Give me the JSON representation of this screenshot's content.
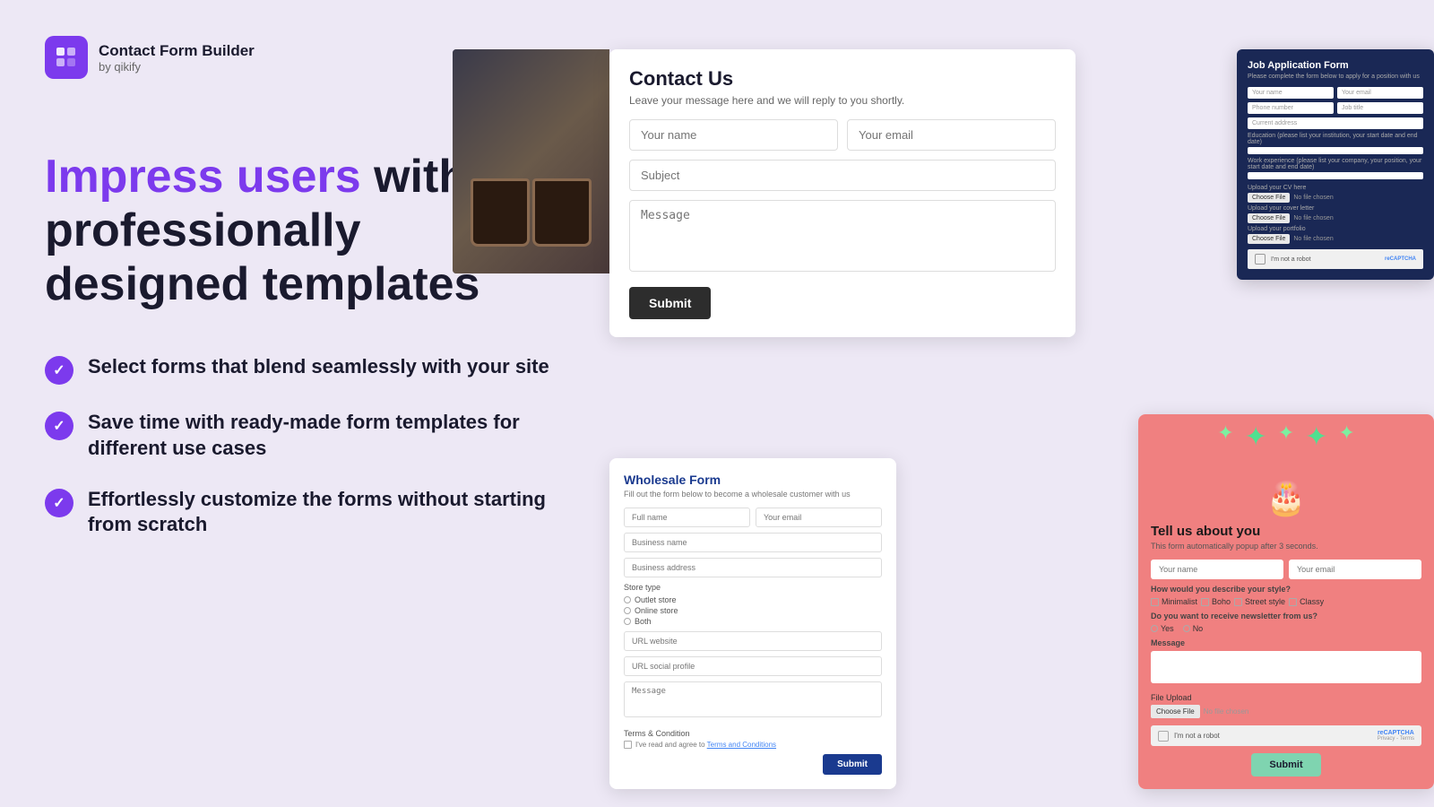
{
  "app": {
    "logo_title": "Contact Form Builder",
    "logo_sub": "by qikify"
  },
  "headline": {
    "highlight": "Impress users",
    "rest": " with professionally designed templates"
  },
  "features": [
    {
      "text": "Select forms that blend seamlessly with your site"
    },
    {
      "text": "Save time with ready-made form templates for different use cases"
    },
    {
      "text": "Effortlessly customize the forms without starting from scratch"
    }
  ],
  "contact_form": {
    "title": "Contact Us",
    "subtitle": "Leave your message here and we will reply to you shortly.",
    "name_placeholder": "Your name",
    "email_placeholder": "Your email",
    "subject_placeholder": "Subject",
    "message_placeholder": "Message",
    "submit_label": "Submit"
  },
  "job_form": {
    "title": "Job Application Form",
    "subtitle": "Please complete the form below to apply for a position with us",
    "name_placeholder": "Your name",
    "email_placeholder": "Your email",
    "phone_placeholder": "Phone number",
    "job_placeholder": "Job title",
    "address_placeholder": "Current address",
    "education_label": "Education (please list your institution, your start date and end date)",
    "work_label": "Work experience (please list your company, your position, your start date and end date)",
    "cv_label": "Upload your CV here",
    "cover_label": "Upload your cover letter",
    "portfolio_label": "Upload your portfolio",
    "choose_file": "Choose File",
    "no_file": "No file chosen",
    "captcha_text": "I'm not a robot",
    "captcha_logo": "reCAPTCHA"
  },
  "wholesale_form": {
    "title": "Wholesale Form",
    "subtitle": "Fill out the form below to become a wholesale customer with us",
    "fullname_placeholder": "Full name",
    "email_placeholder": "Your email",
    "business_placeholder": "Business name",
    "address_placeholder": "Business address",
    "store_type_label": "Store type",
    "store_options": [
      "Outlet store",
      "Online store",
      "Both"
    ],
    "url_placeholder": "URL website",
    "social_placeholder": "URL social profile",
    "message_placeholder": "Message",
    "terms_text": "Terms & Condition",
    "terms_link": "Terms and Conditions",
    "terms_label": "I've read and agree to",
    "submit_label": "Submit"
  },
  "popup_form": {
    "title": "Tell us about you",
    "subtitle": "This form automatically popup after 3 seconds.",
    "name_placeholder": "Your name",
    "email_placeholder": "Your email",
    "style_label": "How would you describe your style?",
    "style_options": [
      "Minimalist",
      "Boho",
      "Street style",
      "Classy"
    ],
    "newsletter_label": "Do you want to receive newsletter from us?",
    "newsletter_options": [
      "Yes",
      "No"
    ],
    "message_label": "Message",
    "file_label": "File Upload",
    "choose_file": "Choose File",
    "no_file": "No file chosen",
    "captcha_text": "I'm not a robot",
    "submit_label": "Submit"
  }
}
